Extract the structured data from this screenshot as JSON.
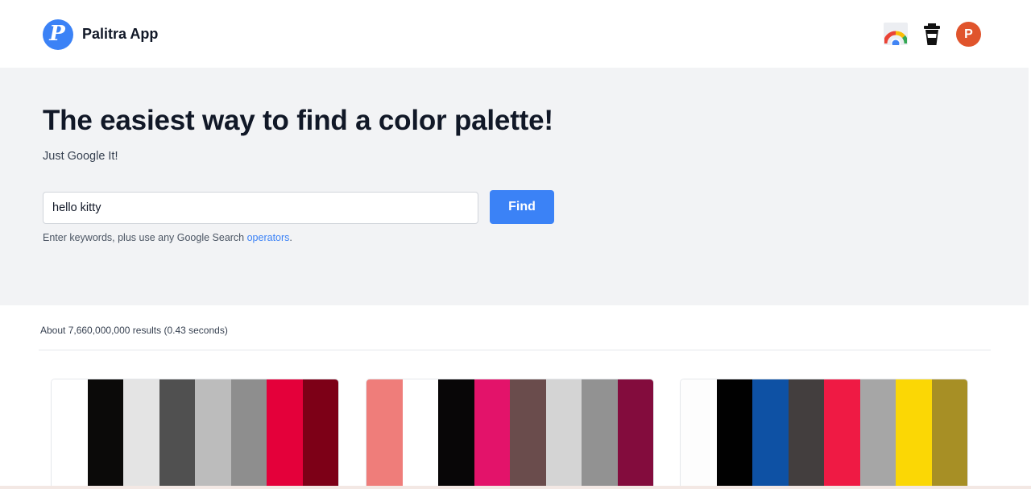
{
  "header": {
    "logo_letter": "P",
    "app_name": "Palitra App",
    "avatar_letter": "P"
  },
  "hero": {
    "title": "The easiest way to find a color palette!",
    "subtitle": "Just Google It!",
    "search_value": "hello kitty",
    "find_label": "Find",
    "hint_prefix": "Enter keywords, plus use any Google Search ",
    "hint_link": "operators",
    "hint_suffix": "."
  },
  "results": {
    "summary": "About 7,660,000,000 results (0.43 seconds)"
  },
  "palettes": [
    {
      "colors": [
        "#ffffff",
        "#0b0a09",
        "#e4e4e4",
        "#505050",
        "#bcbcbc",
        "#8e8e8e",
        "#e4003a",
        "#7d0017"
      ]
    },
    {
      "colors": [
        "#ef7d7a",
        "#ffffff",
        "#080607",
        "#e3136a",
        "#6a4c4c",
        "#d4d4d4",
        "#929292",
        "#830c3d"
      ]
    },
    {
      "colors": [
        "#fdfdfd",
        "#010101",
        "#0e51a4",
        "#433e3e",
        "#ef1a44",
        "#a6a6a6",
        "#fbd705",
        "#a78f25"
      ]
    }
  ],
  "colors": {
    "accent": "#3b82f6",
    "hero_bg": "#f2f3f5",
    "avatar_bg": "#e0542c"
  },
  "icons": {
    "logo": "palitra-logo-icon",
    "chrome_extension": "chrome-extension-icon",
    "coffee": "coffee-cup-icon"
  }
}
